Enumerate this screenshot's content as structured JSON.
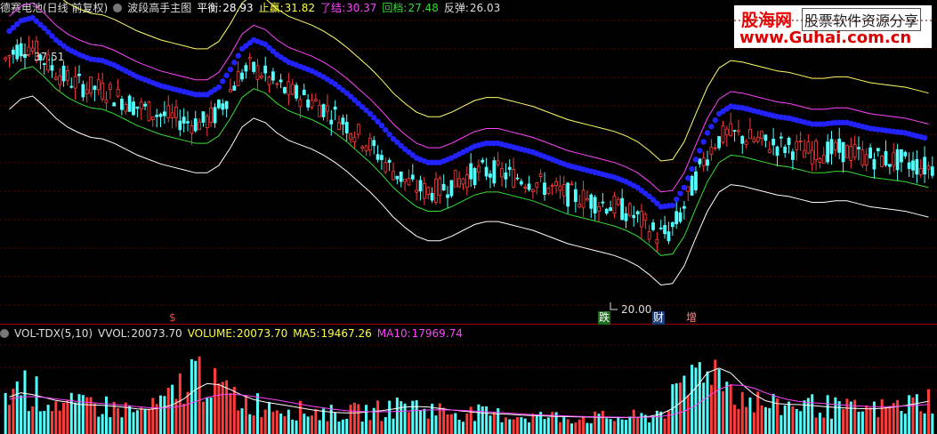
{
  "header": {
    "stock": "德赛电池(日线 前复权)",
    "indicator": "波段高手主图",
    "balance_label": "平衡:",
    "balance": "28.93",
    "stop_profit_label": "止赢:",
    "stop_profit": "31.82",
    "close_out_label": "了结:",
    "close_out": "30.37",
    "pullback_label": "回档:",
    "pullback": "27.48",
    "rebound_label": "反弹:",
    "rebound": "26.03"
  },
  "volume_header": {
    "name": "VOL-TDX(5,10)",
    "vvol_label": "VVOL:",
    "vvol": "20073.70",
    "volume_label": "VOLUME:",
    "volume": "20073.70",
    "ma5_label": "MA5:",
    "ma5": "19467.26",
    "ma10_label": "MA10:",
    "ma10": "17969.74"
  },
  "annotations": {
    "high": "37.51",
    "low": "20.00"
  },
  "events": {
    "e1": "$",
    "e2": "跌",
    "e3": "财",
    "e4": "增"
  },
  "watermark": {
    "brand": "股海网",
    "slogan": "股票软件资源分享",
    "url": "www.Guhai.com.cn"
  },
  "colors": {
    "up": "#ff3c3c",
    "down": "#54ffff",
    "dots": "#2222ff",
    "band_outer_top": "#ffff66",
    "band_inner_top": "#ff44ff",
    "band_inner_bottom": "#33dd33",
    "band_outer_bottom": "#ffffff",
    "ma5": "#ffffff",
    "ma10": "#ff44ff",
    "grid": "#8a0000"
  },
  "chart_data": {
    "type": "candlestick",
    "title": "德赛电池(日线 前复权)",
    "ylim": [
      19,
      39
    ],
    "close_series": [
      36.2,
      36.9,
      37.1,
      36.4,
      35.6,
      35.0,
      34.6,
      34.3,
      34.2,
      33.9,
      33.5,
      33.1,
      32.8,
      32.5,
      32.3,
      32.1,
      31.9,
      31.9,
      32.4,
      33.6,
      35.0,
      35.6,
      35.3,
      34.6,
      34.1,
      33.8,
      33.5,
      33.1,
      32.6,
      32.0,
      31.3,
      30.6,
      29.8,
      28.9,
      28.2,
      27.6,
      27.3,
      27.3,
      27.6,
      28.0,
      28.4,
      28.6,
      28.6,
      28.4,
      28.2,
      28.0,
      27.7,
      27.4,
      27.1,
      26.9,
      26.7,
      26.5,
      26.3,
      26.0,
      25.6,
      25.0,
      24.3,
      24.4,
      25.6,
      27.5,
      29.3,
      30.6,
      31.1,
      31.0,
      30.8,
      30.6,
      30.4,
      30.3,
      30.1,
      29.9,
      29.9,
      30.0,
      30.0,
      29.8,
      29.6,
      29.5,
      29.4,
      29.3,
      29.1,
      28.9
    ],
    "band_offsets": {
      "outer_top": 5.0,
      "inner_top": 2.9,
      "inner_bottom": -1.4,
      "outer_bottom": -3.4
    },
    "volume_ylim": [
      0,
      40000
    ],
    "volume_series": [
      18000,
      21000,
      17500,
      15200,
      13800,
      12500,
      12000,
      13500,
      12100,
      11200,
      10800,
      9600,
      11000,
      13200,
      15800,
      21000,
      26500,
      24000,
      19800,
      16800,
      14200,
      13200,
      12800,
      12200,
      11200,
      10000,
      9800,
      9200,
      8900,
      9100,
      9400,
      9800,
      10200,
      11500,
      13200,
      12100,
      11000,
      10200,
      9700,
      9400,
      8900,
      8600,
      8300,
      8100,
      7900,
      7700,
      7500,
      7400,
      7300,
      7200,
      7100,
      7000,
      7000,
      7100,
      7300,
      7600,
      9800,
      15200,
      18900,
      27500,
      32000,
      27000,
      21000,
      16500,
      14000,
      12500,
      12000,
      12500,
      13000,
      12400,
      11800,
      11200,
      10800,
      10600,
      10500,
      11000,
      11800,
      12600,
      13800,
      15000
    ],
    "ma5_series": [
      16000,
      17800,
      17000,
      15800,
      14500,
      13800,
      12800,
      12600,
      12400,
      12000,
      11500,
      10900,
      10600,
      11200,
      12600,
      15200,
      19200,
      21800,
      21300,
      19200,
      16800,
      14900,
      13800,
      13000,
      12200,
      11300,
      10500,
      9800,
      9300,
      9100,
      9200,
      9600,
      10100,
      10800,
      11700,
      11900,
      11700,
      11000,
      10400,
      9900,
      9400,
      9000,
      8700,
      8500,
      8200,
      8000,
      7800,
      7600,
      7500,
      7400,
      7300,
      7200,
      7100,
      7100,
      7200,
      7600,
      8600,
      11000,
      14800,
      20000,
      26500,
      28500,
      26400,
      21400,
      17200,
      14400,
      13200,
      12800,
      12700,
      12300,
      11900,
      11500,
      11200,
      11000,
      10900,
      11100,
      11600,
      12300,
      13200,
      14200
    ],
    "ma10_series": [
      15000,
      16000,
      16200,
      15800,
      15200,
      14600,
      14000,
      13600,
      13200,
      12800,
      12300,
      11800,
      11400,
      11200,
      11500,
      12300,
      14000,
      15800,
      16800,
      17300,
      16900,
      16200,
      15500,
      14700,
      13800,
      12900,
      12000,
      11300,
      10600,
      10100,
      9800,
      9600,
      9600,
      9700,
      9900,
      10200,
      10400,
      10500,
      10400,
      10200,
      9900,
      9600,
      9300,
      9000,
      8700,
      8400,
      8200,
      8000,
      7800,
      7600,
      7500,
      7400,
      7300,
      7200,
      7200,
      7300,
      7600,
      8400,
      9800,
      12400,
      16000,
      19300,
      21200,
      21000,
      19800,
      17800,
      16100,
      14800,
      14000,
      13500,
      13200,
      12800,
      12400,
      12100,
      11900,
      11800,
      11900,
      12100,
      12400,
      12800
    ]
  }
}
